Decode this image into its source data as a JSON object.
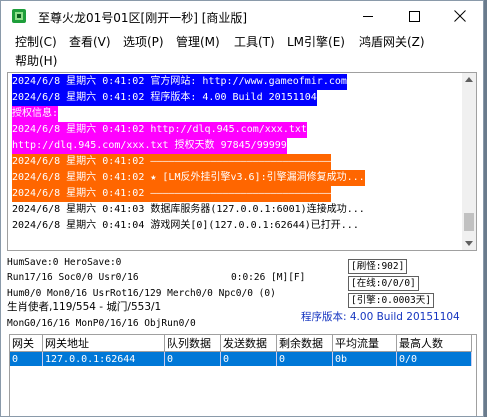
{
  "window": {
    "title": "至尊火龙01号01区[刚开一秒] [商业版]",
    "controls": {
      "minimize": "minimize",
      "maximize": "maximize",
      "close": "close"
    }
  },
  "menu": [
    {
      "label": "控制(C)"
    },
    {
      "label": "查看(V)"
    },
    {
      "label": "选项(P)"
    },
    {
      "label": "管理(M)"
    },
    {
      "label": "工具(T)"
    },
    {
      "label": "LM引擎(E)"
    },
    {
      "label": "鸿盾网关(Z)"
    },
    {
      "label": "帮助(H)"
    }
  ],
  "log": [
    {
      "text": "2024/6/8 星期六 0:41:02 官方网站: http://www.gameofmir.com",
      "fg": "#ffffff",
      "bg": "#0000ff"
    },
    {
      "text": "2024/6/8 星期六 0:41:02 程序版本: 4.00 Build 20151104",
      "fg": "#ffffff",
      "bg": "#0000ff"
    },
    {
      "text": "授权信息:",
      "fg": "#ffffff",
      "bg": "#ff00ff"
    },
    {
      "text": "2024/6/8 星期六 0:41:02 http://dlq.945.com/xxx.txt",
      "fg": "#ffffff",
      "bg": "#ff00ff"
    },
    {
      "text": "http://dlq.945.com/xxx.txt 授权天数 97845/99999",
      "fg": "#ffffff",
      "bg": "#ff00ff"
    },
    {
      "text": "2024/6/8 星期六 0:41:02 ——————————————————————————————",
      "fg": "#ffffff",
      "bg": "#ff6600"
    },
    {
      "text": "2024/6/8 星期六 0:41:02 ★ [LM反外挂引擎v3.6]:引擎漏洞修复成功...",
      "fg": "#ffffff",
      "bg": "#ff6600"
    },
    {
      "text": "2024/6/8 星期六 0:41:02 ——————————————————————————————",
      "fg": "#ffffff",
      "bg": "#ff6600"
    },
    {
      "text": "2024/6/8 星期六 0:41:03 数据库服务器(127.0.0.1:6001)连接成功...",
      "fg": "#000000",
      "bg": "transparent"
    },
    {
      "text": "2024/6/8 星期六 0:41:04 游戏网关[0](127.0.0.1:62644)已打开...",
      "fg": "#000000",
      "bg": "transparent"
    }
  ],
  "status": {
    "line1": "HumSave:0 HeroSave:0",
    "refresh": "[刷怪:902]",
    "line2": "Run17/16 Soc0/0 Usr0/16",
    "time": "0:0:26 [M][F]",
    "online": "[在线:0/0/0]",
    "line3": "Hum0/0 Mon0/16 UsrRot16/129 Merch0/0 Npc0/0 (0)",
    "engine": "[引擎:0.0003天]",
    "line4": "生肖使者,119/554 - 城门/553/1",
    "version": "程序版本: 4.00 Build 20151104",
    "line5": "MonG0/16/16 MonP0/16/16 ObjRun0/0"
  },
  "gateways": {
    "columns": [
      "网关",
      "网关地址",
      "队列数据",
      "发送数据",
      "剩余数据",
      "平均流量",
      "最高人数"
    ],
    "rows": [
      [
        "0",
        "127.0.0.1:62644",
        "0",
        "0",
        "0",
        "0b",
        "0/0"
      ]
    ]
  }
}
